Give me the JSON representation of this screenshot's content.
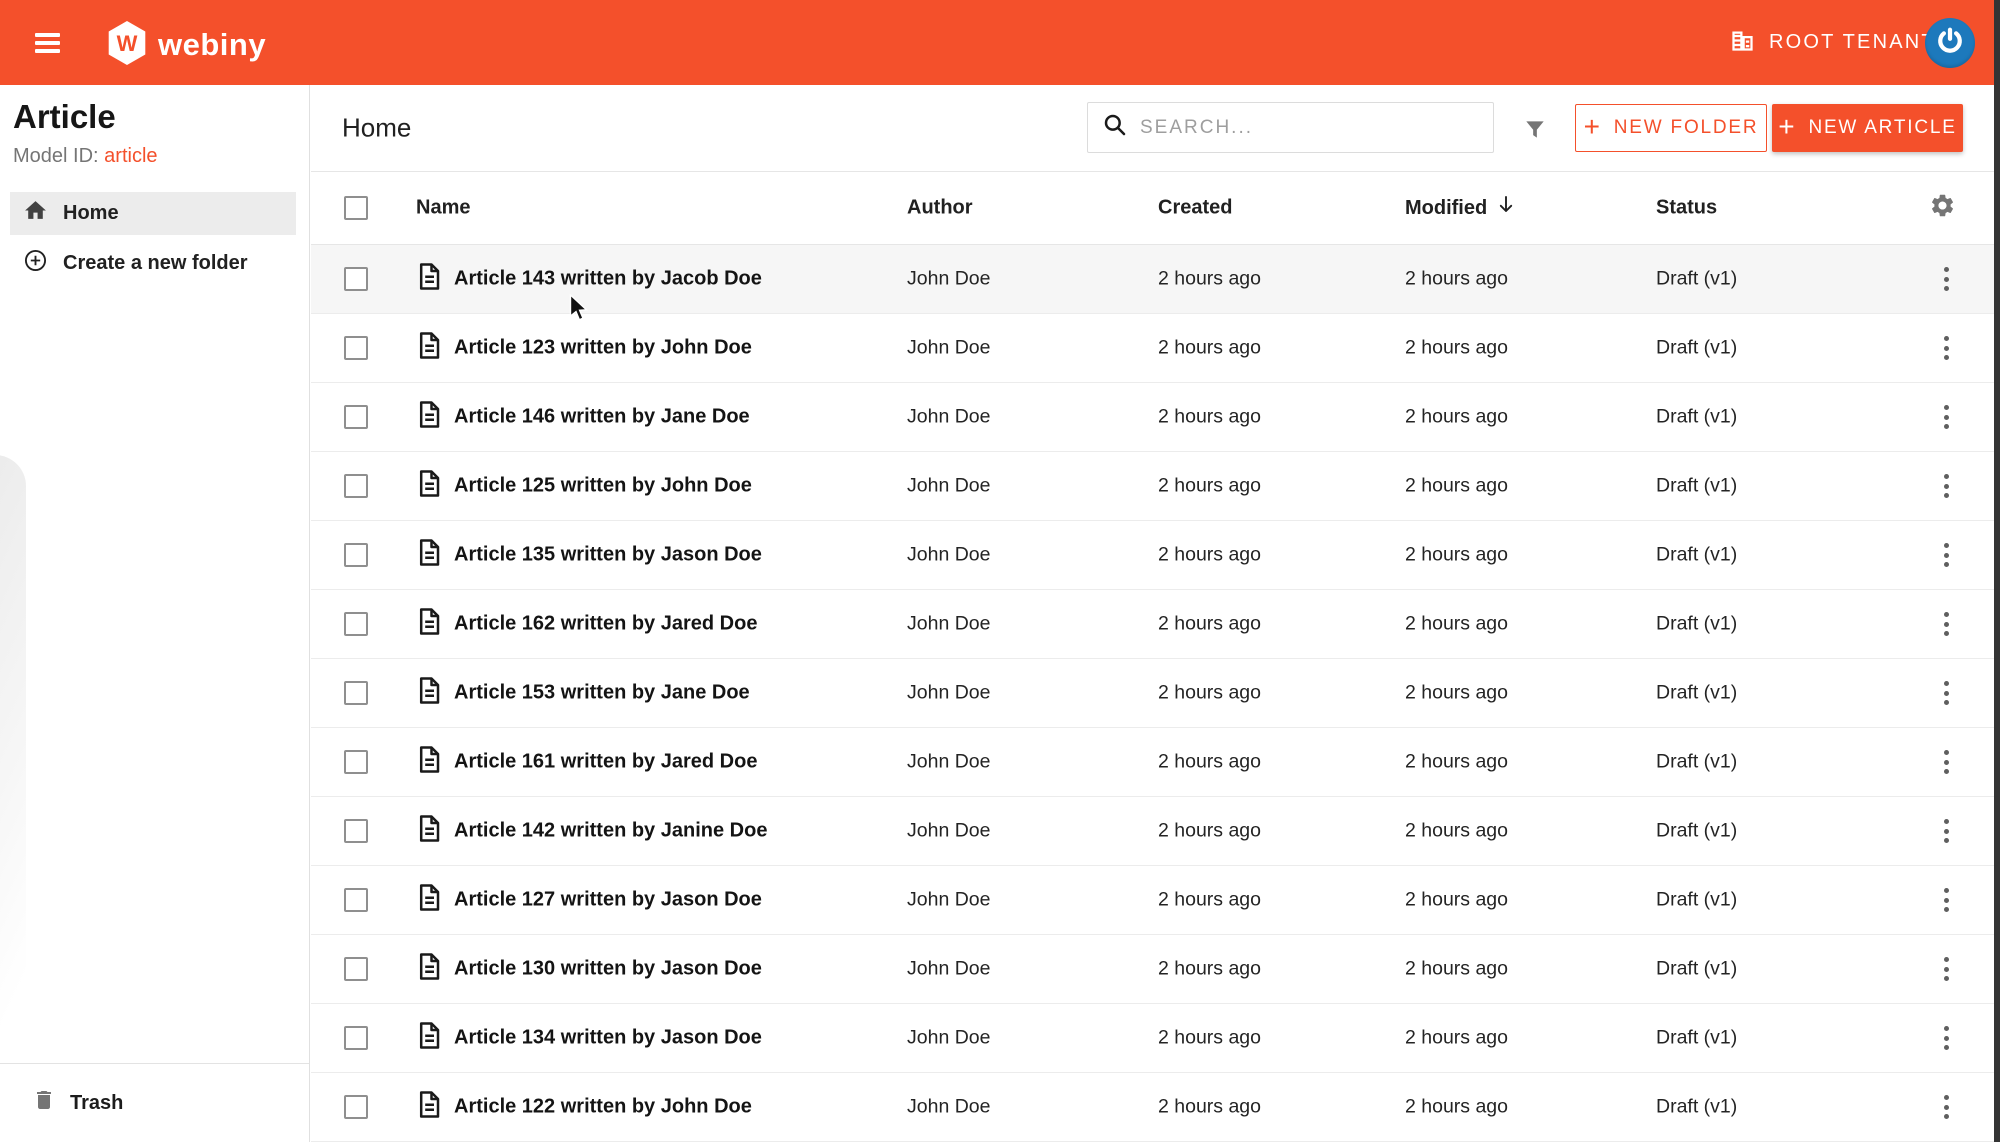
{
  "topbar": {
    "brand": "webiny",
    "tenant": "ROOT TENANT"
  },
  "sidebar": {
    "title": "Article",
    "model_id_label": "Model ID:",
    "model_id_value": "article",
    "nav": {
      "home": "Home",
      "create_folder": "Create a new folder"
    },
    "trash": "Trash"
  },
  "main": {
    "breadcrumb": "Home",
    "search_placeholder": "SEARCH...",
    "buttons": {
      "new_folder": "NEW FOLDER",
      "new_article": "NEW ARTICLE"
    }
  },
  "table": {
    "columns": {
      "name": "Name",
      "author": "Author",
      "created": "Created",
      "modified": "Modified",
      "status": "Status"
    },
    "sorted_by": "Modified",
    "sort_direction": "descending",
    "rows": [
      {
        "name": "Article 143 written by Jacob Doe",
        "author": "John Doe",
        "created": "2 hours ago",
        "modified": "2 hours ago",
        "status": "Draft (v1)",
        "hovered": true
      },
      {
        "name": "Article 123 written by John Doe",
        "author": "John Doe",
        "created": "2 hours ago",
        "modified": "2 hours ago",
        "status": "Draft (v1)",
        "hovered": false
      },
      {
        "name": "Article 146 written by Jane Doe",
        "author": "John Doe",
        "created": "2 hours ago",
        "modified": "2 hours ago",
        "status": "Draft (v1)",
        "hovered": false
      },
      {
        "name": "Article 125 written by John Doe",
        "author": "John Doe",
        "created": "2 hours ago",
        "modified": "2 hours ago",
        "status": "Draft (v1)",
        "hovered": false
      },
      {
        "name": "Article 135 written by Jason Doe",
        "author": "John Doe",
        "created": "2 hours ago",
        "modified": "2 hours ago",
        "status": "Draft (v1)",
        "hovered": false
      },
      {
        "name": "Article 162 written by Jared Doe",
        "author": "John Doe",
        "created": "2 hours ago",
        "modified": "2 hours ago",
        "status": "Draft (v1)",
        "hovered": false
      },
      {
        "name": "Article 153 written by Jane Doe",
        "author": "John Doe",
        "created": "2 hours ago",
        "modified": "2 hours ago",
        "status": "Draft (v1)",
        "hovered": false
      },
      {
        "name": "Article 161 written by Jared Doe",
        "author": "John Doe",
        "created": "2 hours ago",
        "modified": "2 hours ago",
        "status": "Draft (v1)",
        "hovered": false
      },
      {
        "name": "Article 142 written by Janine Doe",
        "author": "John Doe",
        "created": "2 hours ago",
        "modified": "2 hours ago",
        "status": "Draft (v1)",
        "hovered": false
      },
      {
        "name": "Article 127 written by Jason Doe",
        "author": "John Doe",
        "created": "2 hours ago",
        "modified": "2 hours ago",
        "status": "Draft (v1)",
        "hovered": false
      },
      {
        "name": "Article 130 written by Jason Doe",
        "author": "John Doe",
        "created": "2 hours ago",
        "modified": "2 hours ago",
        "status": "Draft (v1)",
        "hovered": false
      },
      {
        "name": "Article 134 written by Jason Doe",
        "author": "John Doe",
        "created": "2 hours ago",
        "modified": "2 hours ago",
        "status": "Draft (v1)",
        "hovered": false
      },
      {
        "name": "Article 122 written by John Doe",
        "author": "John Doe",
        "created": "2 hours ago",
        "modified": "2 hours ago",
        "status": "Draft (v1)",
        "hovered": false
      }
    ]
  },
  "icons": {
    "menu": "hamburger-icon",
    "logo": "webiny-hexagon-logo",
    "tenant": "building-icon",
    "avatar": "power-icon",
    "search": "magnifier-icon",
    "filter": "funnel-icon",
    "settings": "gear-icon",
    "sort": "arrow-down-icon",
    "row_file": "file-text-icon",
    "row_menu": "kebab-icon",
    "home": "home-icon",
    "create_folder": "circle-plus-icon",
    "trash": "trash-icon"
  },
  "colors": {
    "accent": "#F4502B",
    "topbar_bg": "#F4502B",
    "avatar_blue": "#1D79BC",
    "selected_nav_bg": "#ececec",
    "hover_row_bg": "#f6f6f6"
  }
}
